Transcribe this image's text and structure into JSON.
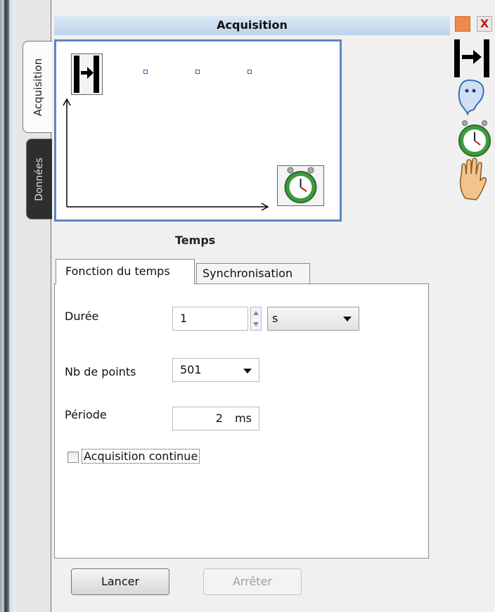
{
  "window": {
    "title": "Acquisition",
    "close_glyph": "X"
  },
  "vertical_tabs": [
    {
      "label": "Acquisition",
      "active": true
    },
    {
      "label": "Données",
      "active": false
    }
  ],
  "preview": {
    "trigger_icon": "trigger-start-icon",
    "timer_icon": "stopwatch-icon",
    "marker_count": 3
  },
  "side_toolbar": {
    "icons": [
      "trigger-start-icon",
      "ghost-icon",
      "stopwatch-icon",
      "hand-stop-icon"
    ]
  },
  "section_title": "Temps",
  "tabs": [
    {
      "label": "Fonction du temps",
      "active": true
    },
    {
      "label": "Synchronisation",
      "active": false
    }
  ],
  "form": {
    "duree": {
      "label": "Durée",
      "value": "1",
      "unit": "s"
    },
    "nb_points": {
      "label": "Nb de points",
      "value": "501"
    },
    "periode": {
      "label": "Période",
      "value": "2",
      "unit": "ms"
    },
    "continue": {
      "label": "Acquisition continue",
      "checked": false
    }
  },
  "buttons": {
    "start": "Lancer",
    "stop": "Arrêter"
  },
  "colors": {
    "accent": "#5b86c6",
    "title_bar": "#c9dcef",
    "close_red": "#c21a1a",
    "orange": "#f08a4a"
  }
}
